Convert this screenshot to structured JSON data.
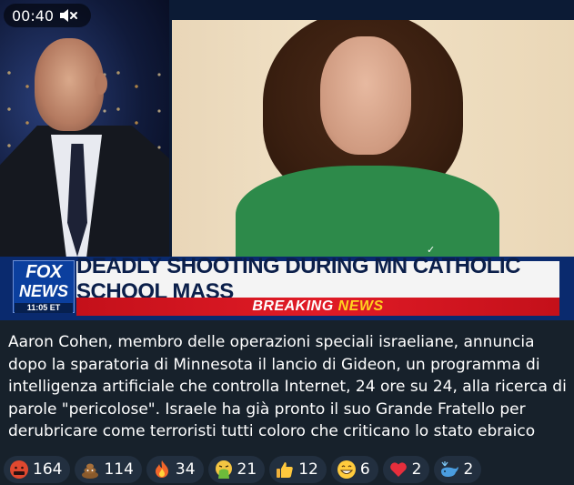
{
  "video": {
    "elapsed_time": "00:40",
    "muted": true,
    "lower_third": {
      "network_line1": "FOX",
      "network_line2": "NEWS",
      "time": "11:05 ET",
      "headline": "DEADLY SHOOTING DURING MN CATHOLIC SCHOOL MASS",
      "breaking_part1": "BREAKING",
      "breaking_part2": "NEWS"
    }
  },
  "post": {
    "caption": "Aaron Cohen, membro delle operazioni speciali israeliane, annuncia dopo la sparatoria di Minnesota il lancio di Gideon, un programma di intelligenza artificiale che controlla Internet, 24 ore su 24, alla ricerca di parole \"pericolose\". Israele ha già pronto il suo Grande Fratello per derubricare come terroristi tutti coloro che criticano lo stato ebraico"
  },
  "reactions": [
    {
      "icon": "angry-cursing-face-icon",
      "count": "164"
    },
    {
      "icon": "pile-of-poo-icon",
      "count": "114"
    },
    {
      "icon": "fire-icon",
      "count": "34"
    },
    {
      "icon": "vomiting-face-icon",
      "count": "21"
    },
    {
      "icon": "thumbs-up-icon",
      "count": "12"
    },
    {
      "icon": "grinning-face-icon",
      "count": "6"
    },
    {
      "icon": "red-heart-icon",
      "count": "2"
    },
    {
      "icon": "spouting-whale-icon",
      "count": "2"
    }
  ],
  "colors": {
    "background": "#17212b",
    "reaction_pill": "#222f3f",
    "fox_blue": "#0b3f9e",
    "breaking_red": "#e01b26"
  }
}
